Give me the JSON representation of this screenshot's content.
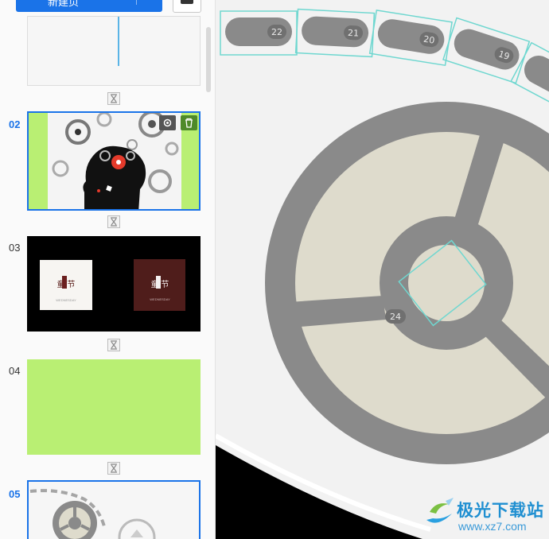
{
  "toolbar": {
    "new_button_label": "新建页",
    "camera_icon": "camera-icon"
  },
  "slides": [
    {
      "number": "",
      "type": "partial",
      "selected": false
    },
    {
      "number": "02",
      "type": "gears-head",
      "selected": true
    },
    {
      "number": "03",
      "type": "dark-doors",
      "selected": false
    },
    {
      "number": "04",
      "type": "green-blank",
      "selected": false
    },
    {
      "number": "05",
      "type": "wheel",
      "selected": true
    }
  ],
  "slide_actions": {
    "settings_icon": "gear-icon",
    "delete_icon": "trash-icon"
  },
  "slide03": {
    "left_card_text": "童 节",
    "right_card_text": "童 节",
    "card_sub": "WEDNESDAY"
  },
  "canvas": {
    "badges": [
      "22",
      "21",
      "20",
      "19",
      "24"
    ]
  },
  "watermark": {
    "brand": "极光下载站",
    "url": "www.xz7.com"
  },
  "colors": {
    "accent": "#1a73e8",
    "lime": "#b9ef73",
    "wheel_gray": "#8a8a8a",
    "wheel_cream": "#dedbcc",
    "selection_cyan": "#6fd7d0"
  }
}
